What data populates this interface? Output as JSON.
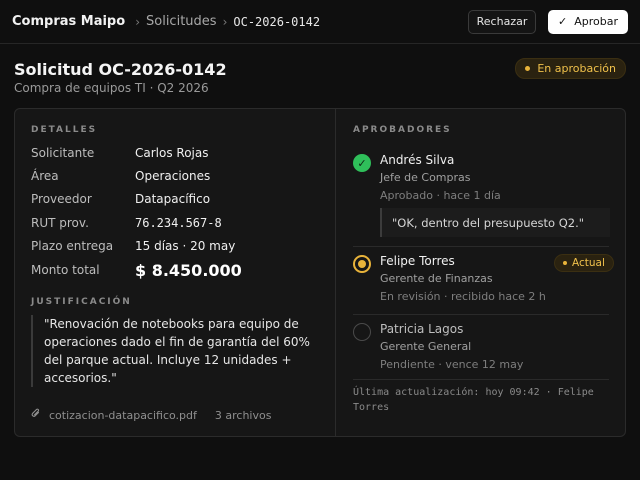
{
  "header": {
    "brand": "Compras Maipo",
    "breadcrumb_section": "Solicitudes",
    "breadcrumb_current": "OC-2026-0142",
    "reject_label": "Rechazar",
    "approve_label": "Aprobar"
  },
  "request": {
    "title": "Solicitud OC-2026-0142",
    "subtitle": "Compra de equipos TI · Q2 2026",
    "status": "En aprobación"
  },
  "details": {
    "section_label": "DETALLES",
    "rows": [
      {
        "key": "Solicitante",
        "value": "Carlos Rojas"
      },
      {
        "key": "Área",
        "value": "Operaciones"
      },
      {
        "key": "Proveedor",
        "value": "Datapacífico"
      },
      {
        "key": "RUT prov.",
        "value": "76.234.567-8"
      },
      {
        "key": "Plazo entrega",
        "value": "15 días · 20 may"
      },
      {
        "key": "Monto total",
        "value": "$ 8.450.000"
      }
    ],
    "justification_label": "JUSTIFICACIÓN",
    "justification": "\"Renovación de notebooks para equipo de operaciones dado el fin de garantía del 60% del parque actual. Incluye 12 unidades + accesorios.\"",
    "attachment": "cotizacion-datapacifico.pdf",
    "attachment_count": "3 archivos"
  },
  "approvers": {
    "section_label": "APROBADORES",
    "items": [
      {
        "name": "Andrés Silva",
        "role": "Jefe de Compras",
        "meta": "Aprobado · hace 1 día",
        "comment": "\"OK, dentro del presupuesto Q2.\"",
        "state": "approved"
      },
      {
        "name": "Felipe Torres",
        "role": "Gerente de Finanzas",
        "meta": "En revisión · recibido hace 2 h",
        "badge": "Actual",
        "state": "current"
      },
      {
        "name": "Patricia Lagos",
        "role": "Gerente General",
        "meta": "Pendiente · vence 12 may",
        "state": "pending"
      }
    ],
    "last_update": "Última actualización: hoy 09:42 · Felipe Torres"
  },
  "colors": {
    "accent_amber": "#e8b33a",
    "approved_green": "#2fbf5a",
    "background": "#0f0f0f"
  },
  "icons": [
    "check-icon",
    "paperclip-icon",
    "approved-check-icon",
    "current-status-icon",
    "pending-status-icon"
  ]
}
